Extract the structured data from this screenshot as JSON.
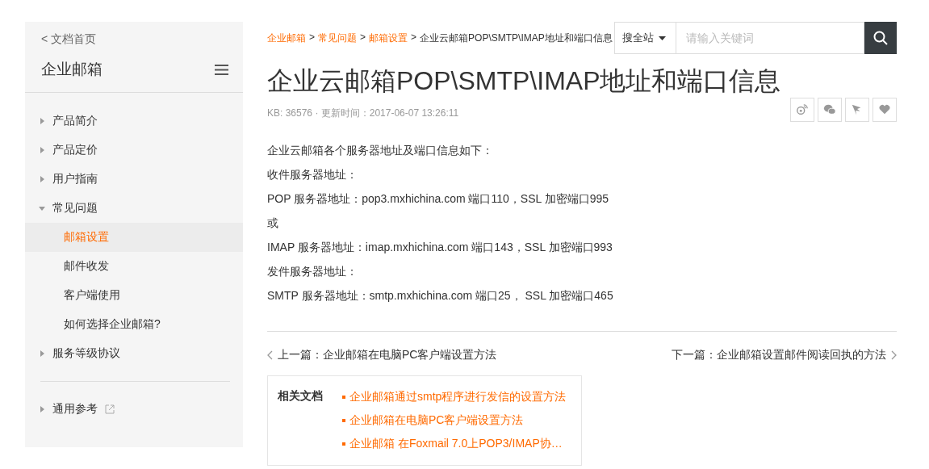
{
  "sidebar": {
    "back_link": "< 文档首页",
    "title": "企业邮箱",
    "nav_items": [
      {
        "label": "产品简介",
        "expanded": false
      },
      {
        "label": "产品定价",
        "expanded": false
      },
      {
        "label": "用户指南",
        "expanded": false
      },
      {
        "label": "常见问题",
        "expanded": true,
        "children": [
          {
            "label": "邮箱设置",
            "selected": true
          },
          {
            "label": "邮件收发",
            "selected": false
          },
          {
            "label": "客户端使用",
            "selected": false
          },
          {
            "label": "如何选择企业邮箱?",
            "selected": false
          }
        ]
      },
      {
        "label": "服务等级协议",
        "expanded": false
      }
    ],
    "footer_items": [
      {
        "label": "通用参考",
        "expanded": false,
        "external": true
      }
    ]
  },
  "breadcrumb": [
    {
      "label": "企业邮箱",
      "kind": "link"
    },
    {
      "label": ">",
      "kind": "separator"
    },
    {
      "label": "常见问题",
      "kind": "link"
    },
    {
      "label": ">",
      "kind": "separator"
    },
    {
      "label": "邮箱设置",
      "kind": "link"
    },
    {
      "label": ">",
      "kind": "separator"
    },
    {
      "label": "企业云邮箱POP\\SMTP\\IMAP地址和端口信息",
      "kind": "current"
    }
  ],
  "search": {
    "scope": "搜全站",
    "placeholder": "请输入关键词"
  },
  "article": {
    "title": "企业云邮箱POP\\SMTP\\IMAP地址和端口信息",
    "meta": "KB: 36576 · 更新时间：2017-06-07 13:26:11",
    "paragraphs": [
      "企业云邮箱各个服务器地址及端口信息如下：",
      "收件服务器地址：",
      "POP 服务器地址：pop3.mxhichina.com 端口110，SSL 加密端口995",
      "或",
      "IMAP 服务器地址：imap.mxhichina.com 端口143，SSL 加密端口993",
      "发件服务器地址：",
      "SMTP 服务器地址：smtp.mxhichina.com 端口25， SSL 加密端口465"
    ]
  },
  "pager": {
    "prev": "上一篇：企业邮箱在电脑PC客户端设置方法",
    "next": "下一篇：企业邮箱设置邮件阅读回执的方法"
  },
  "related": {
    "heading": "相关文档",
    "links": [
      "企业邮箱通过smtp程序进行发信的设置方法",
      "企业邮箱在电脑PC客户端设置方法",
      "企业邮箱 在Foxmail 7.0上POP3/IMAP协…"
    ]
  }
}
